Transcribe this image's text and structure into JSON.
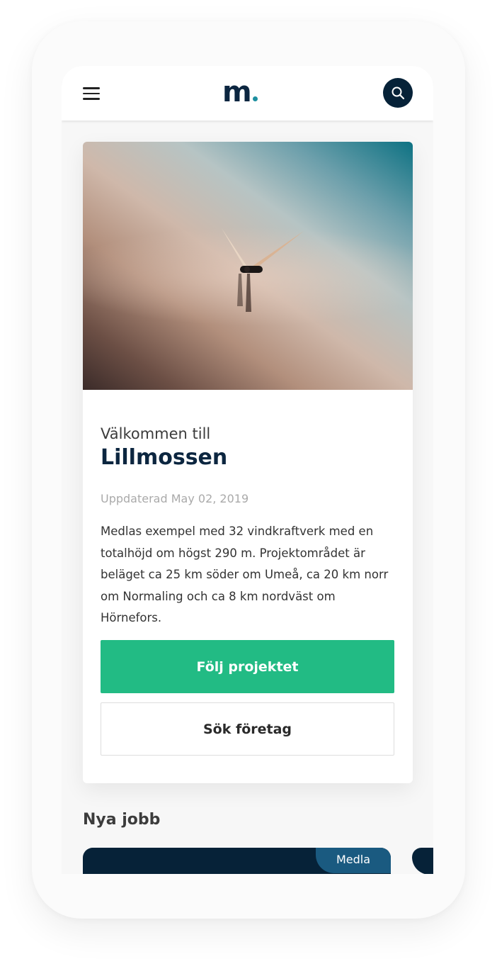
{
  "header": {
    "logo_text": "m",
    "menu_icon": "hamburger-menu-icon",
    "search_icon": "search-icon"
  },
  "project": {
    "welcome": "Välkommen till",
    "name": "Lillmossen",
    "updated": "Uppdaterad May 02, 2019",
    "description": "Medlas exempel med 32 vindkraftverk med en totalhöjd om högst 290 m. Projektområdet är beläget ca 25 km söder om Umeå, ca 20 km norr om Normaling och ca 8 km nordväst om Hörnefors.",
    "follow_label": "Följ projektet",
    "search_company_label": "Sök företag"
  },
  "jobs": {
    "section_title": "Nya jobb",
    "items": [
      {
        "tag": "Medla"
      }
    ]
  },
  "colors": {
    "navy": "#062238",
    "green": "#22bb84",
    "teal_dot": "#1d8fa0",
    "tag_blue": "#1a5a80"
  }
}
